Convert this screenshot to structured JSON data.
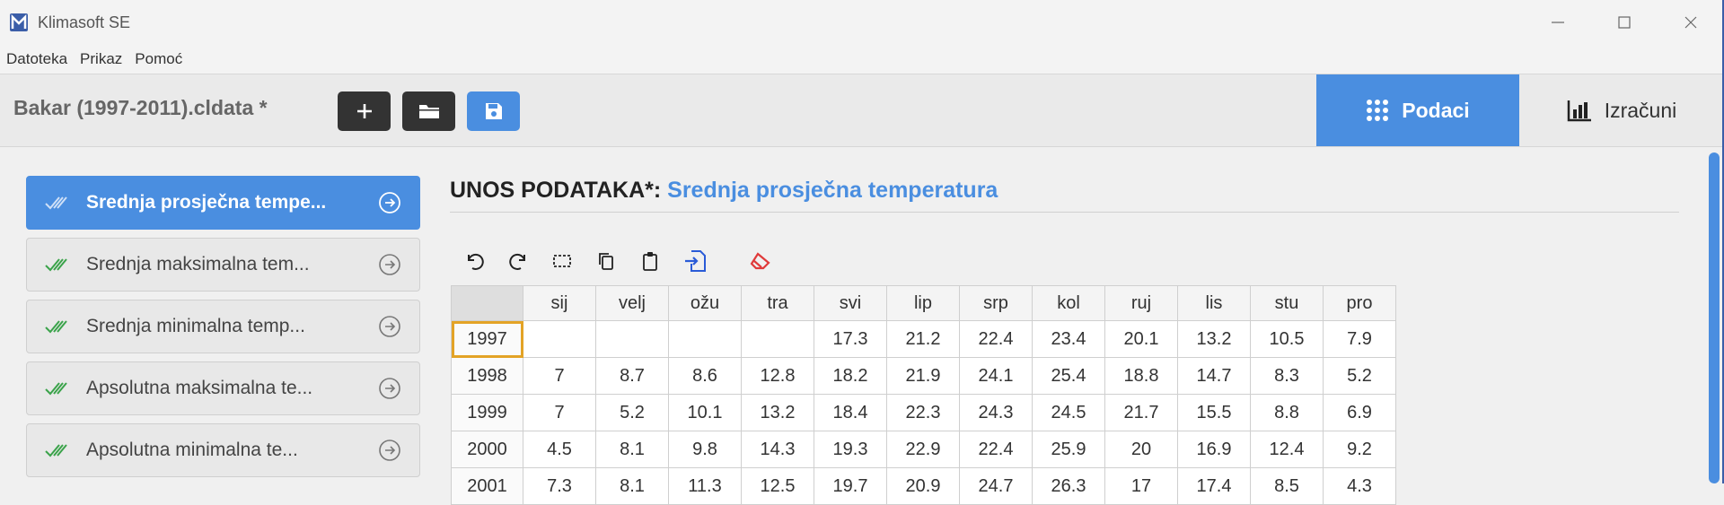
{
  "window": {
    "title": "Klimasoft SE"
  },
  "menu": [
    "Datoteka",
    "Prikaz",
    "Pomoć"
  ],
  "toolbar": {
    "file_title": "Bakar (1997-2011).cldata *"
  },
  "modes": {
    "active": "Podaci",
    "inactive": "Izračuni"
  },
  "sidebar": [
    {
      "label": "Srednja prosječna tempe...",
      "active": true
    },
    {
      "label": "Srednja maksimalna tem...",
      "active": false
    },
    {
      "label": "Srednja minimalna temp...",
      "active": false
    },
    {
      "label": "Apsolutna maksimalna te...",
      "active": false
    },
    {
      "label": "Apsolutna minimalna te...",
      "active": false
    }
  ],
  "content": {
    "title_prefix": "UNOS PODATAKA*:",
    "title_sub": "Srednja prosječna temperatura"
  },
  "table": {
    "columns": [
      "sij",
      "velj",
      "ožu",
      "tra",
      "svi",
      "lip",
      "srp",
      "kol",
      "ruj",
      "lis",
      "stu",
      "pro"
    ],
    "rows": [
      {
        "year": "1997",
        "values": [
          "",
          "",
          "",
          "",
          "17.3",
          "21.2",
          "22.4",
          "23.4",
          "20.1",
          "13.2",
          "10.5",
          "7.9"
        ]
      },
      {
        "year": "1998",
        "values": [
          "7",
          "8.7",
          "8.6",
          "12.8",
          "18.2",
          "21.9",
          "24.1",
          "25.4",
          "18.8",
          "14.7",
          "8.3",
          "5.2"
        ]
      },
      {
        "year": "1999",
        "values": [
          "7",
          "5.2",
          "10.1",
          "13.2",
          "18.4",
          "22.3",
          "24.3",
          "24.5",
          "21.7",
          "15.5",
          "8.8",
          "6.9"
        ]
      },
      {
        "year": "2000",
        "values": [
          "4.5",
          "8.1",
          "9.8",
          "14.3",
          "19.3",
          "22.9",
          "22.4",
          "25.9",
          "20",
          "16.9",
          "12.4",
          "9.2"
        ]
      },
      {
        "year": "2001",
        "values": [
          "7.3",
          "8.1",
          "11.3",
          "12.5",
          "19.7",
          "20.9",
          "24.7",
          "26.3",
          "17",
          "17.4",
          "8.5",
          "4.3"
        ]
      }
    ]
  },
  "colors": {
    "accent": "#4a8ee0",
    "dark_button": "#333333",
    "selection": "#e3a326"
  }
}
